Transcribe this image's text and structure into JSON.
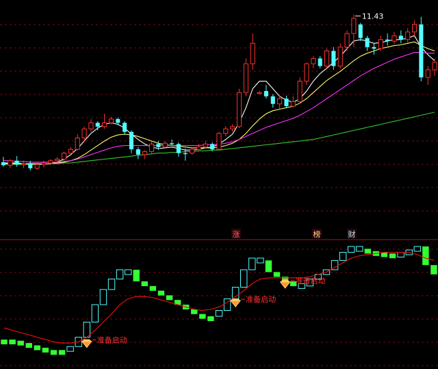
{
  "chart_data": [
    {
      "type": "candlestick",
      "peak_label": "11.43",
      "ylim": [
        9.0,
        11.55
      ],
      "grid": true,
      "candles": [
        {
          "o": 9.48,
          "h": 9.55,
          "l": 9.42,
          "c": 9.44,
          "up": false
        },
        {
          "o": 9.44,
          "h": 9.52,
          "l": 9.4,
          "c": 9.5,
          "up": true
        },
        {
          "o": 9.5,
          "h": 9.56,
          "l": 9.42,
          "c": 9.45,
          "up": false
        },
        {
          "o": 9.45,
          "h": 9.5,
          "l": 9.4,
          "c": 9.46,
          "up": true
        },
        {
          "o": 9.46,
          "h": 9.5,
          "l": 9.37,
          "c": 9.4,
          "up": false
        },
        {
          "o": 9.4,
          "h": 9.48,
          "l": 9.38,
          "c": 9.45,
          "up": true
        },
        {
          "o": 9.45,
          "h": 9.5,
          "l": 9.41,
          "c": 9.47,
          "up": true
        },
        {
          "o": 9.47,
          "h": 9.52,
          "l": 9.44,
          "c": 9.5,
          "up": true
        },
        {
          "o": 9.5,
          "h": 9.55,
          "l": 9.47,
          "c": 9.52,
          "up": true
        },
        {
          "o": 9.52,
          "h": 9.62,
          "l": 9.5,
          "c": 9.6,
          "up": true
        },
        {
          "o": 9.6,
          "h": 9.68,
          "l": 9.58,
          "c": 9.65,
          "up": true
        },
        {
          "o": 9.65,
          "h": 9.85,
          "l": 9.63,
          "c": 9.8,
          "up": true
        },
        {
          "o": 9.8,
          "h": 9.95,
          "l": 9.75,
          "c": 9.92,
          "up": true
        },
        {
          "o": 9.92,
          "h": 10.05,
          "l": 9.88,
          "c": 10.0,
          "up": true
        },
        {
          "o": 10.0,
          "h": 10.02,
          "l": 9.9,
          "c": 9.95,
          "up": false
        },
        {
          "o": 9.95,
          "h": 10.12,
          "l": 9.92,
          "c": 10.0,
          "up": true
        },
        {
          "o": 10.0,
          "h": 10.08,
          "l": 9.98,
          "c": 10.05,
          "up": true
        },
        {
          "o": 10.05,
          "h": 10.07,
          "l": 9.97,
          "c": 10.0,
          "up": false
        },
        {
          "o": 10.0,
          "h": 10.02,
          "l": 9.84,
          "c": 9.88,
          "up": false
        },
        {
          "o": 9.88,
          "h": 9.9,
          "l": 9.6,
          "c": 9.65,
          "up": false
        },
        {
          "o": 9.65,
          "h": 9.68,
          "l": 9.52,
          "c": 9.58,
          "up": false
        },
        {
          "o": 9.58,
          "h": 9.64,
          "l": 9.52,
          "c": 9.62,
          "up": true
        },
        {
          "o": 9.62,
          "h": 9.75,
          "l": 9.6,
          "c": 9.72,
          "up": true
        },
        {
          "o": 9.72,
          "h": 9.76,
          "l": 9.64,
          "c": 9.68,
          "up": false
        },
        {
          "o": 9.68,
          "h": 9.76,
          "l": 9.66,
          "c": 9.73,
          "up": true
        },
        {
          "o": 9.73,
          "h": 9.78,
          "l": 9.7,
          "c": 9.72,
          "up": false
        },
        {
          "o": 9.72,
          "h": 9.74,
          "l": 9.55,
          "c": 9.6,
          "up": false
        },
        {
          "o": 9.6,
          "h": 9.66,
          "l": 9.5,
          "c": 9.6,
          "up": false
        },
        {
          "o": 9.6,
          "h": 9.68,
          "l": 9.58,
          "c": 9.65,
          "up": true
        },
        {
          "o": 9.65,
          "h": 9.72,
          "l": 9.62,
          "c": 9.68,
          "up": true
        },
        {
          "o": 9.68,
          "h": 9.76,
          "l": 9.66,
          "c": 9.72,
          "up": true
        },
        {
          "o": 9.72,
          "h": 9.74,
          "l": 9.62,
          "c": 9.65,
          "up": false
        },
        {
          "o": 9.65,
          "h": 9.88,
          "l": 9.64,
          "c": 9.86,
          "up": true
        },
        {
          "o": 9.86,
          "h": 9.96,
          "l": 9.82,
          "c": 9.92,
          "up": true
        },
        {
          "o": 9.92,
          "h": 9.98,
          "l": 9.88,
          "c": 9.95,
          "up": true
        },
        {
          "o": 9.95,
          "h": 10.45,
          "l": 9.93,
          "c": 10.4,
          "up": true
        },
        {
          "o": 10.4,
          "h": 10.85,
          "l": 10.35,
          "c": 10.78,
          "up": true
        },
        {
          "o": 10.78,
          "h": 11.18,
          "l": 10.7,
          "c": 11.05,
          "up": true
        },
        {
          "o": 10.4,
          "h": 10.42,
          "l": 10.38,
          "c": 10.4,
          "up": true
        },
        {
          "o": 10.42,
          "h": 10.5,
          "l": 10.32,
          "c": 10.35,
          "up": false
        },
        {
          "o": 10.35,
          "h": 10.38,
          "l": 10.2,
          "c": 10.25,
          "up": false
        },
        {
          "o": 10.25,
          "h": 10.36,
          "l": 10.18,
          "c": 10.32,
          "up": true
        },
        {
          "o": 10.32,
          "h": 10.36,
          "l": 10.2,
          "c": 10.22,
          "up": false
        },
        {
          "o": 10.22,
          "h": 10.35,
          "l": 10.2,
          "c": 10.28,
          "up": true
        },
        {
          "o": 10.28,
          "h": 10.6,
          "l": 10.25,
          "c": 10.55,
          "up": true
        },
        {
          "o": 10.55,
          "h": 10.8,
          "l": 10.5,
          "c": 10.78,
          "up": true
        },
        {
          "o": 10.78,
          "h": 10.88,
          "l": 10.72,
          "c": 10.85,
          "up": true
        },
        {
          "o": 10.85,
          "h": 10.88,
          "l": 10.72,
          "c": 10.75,
          "up": false
        },
        {
          "o": 10.75,
          "h": 10.98,
          "l": 10.72,
          "c": 10.95,
          "up": true
        },
        {
          "o": 10.95,
          "h": 11.0,
          "l": 10.7,
          "c": 10.75,
          "up": false
        },
        {
          "o": 10.75,
          "h": 11.05,
          "l": 10.72,
          "c": 11.0,
          "up": true
        },
        {
          "o": 11.0,
          "h": 11.22,
          "l": 10.95,
          "c": 11.18,
          "up": true
        },
        {
          "o": 11.18,
          "h": 11.43,
          "l": 11.0,
          "c": 11.38,
          "up": true
        },
        {
          "o": 11.3,
          "h": 11.32,
          "l": 11.08,
          "c": 11.12,
          "up": false
        },
        {
          "o": 11.12,
          "h": 11.15,
          "l": 10.95,
          "c": 11.0,
          "up": false
        },
        {
          "o": 11.0,
          "h": 11.05,
          "l": 10.9,
          "c": 10.98,
          "up": false
        },
        {
          "o": 10.98,
          "h": 11.15,
          "l": 10.95,
          "c": 11.1,
          "up": true
        },
        {
          "o": 11.1,
          "h": 11.18,
          "l": 11.02,
          "c": 11.08,
          "up": false
        },
        {
          "o": 11.08,
          "h": 11.2,
          "l": 11.04,
          "c": 11.15,
          "up": true
        },
        {
          "o": 11.15,
          "h": 11.22,
          "l": 11.05,
          "c": 11.1,
          "up": false
        },
        {
          "o": 11.1,
          "h": 11.25,
          "l": 11.06,
          "c": 11.2,
          "up": true
        },
        {
          "o": 11.2,
          "h": 11.35,
          "l": 11.15,
          "c": 11.3,
          "up": true
        },
        {
          "o": 11.3,
          "h": 11.4,
          "l": 10.55,
          "c": 10.6,
          "up": false
        },
        {
          "o": 10.6,
          "h": 10.75,
          "l": 10.5,
          "c": 10.7,
          "up": true
        },
        {
          "o": 10.7,
          "h": 10.85,
          "l": 10.62,
          "c": 10.8,
          "up": true
        }
      ],
      "ma_lines": [
        {
          "color": "#ffffff",
          "values": [
            9.47,
            9.47,
            9.47,
            9.46,
            9.45,
            9.45,
            9.45,
            9.46,
            9.48,
            9.52,
            9.58,
            9.66,
            9.76,
            9.86,
            9.93,
            9.98,
            10.0,
            9.98,
            9.93,
            9.85,
            9.78,
            9.72,
            9.68,
            9.66,
            9.67,
            9.68,
            9.66,
            9.64,
            9.64,
            9.65,
            9.67,
            9.68,
            9.72,
            9.78,
            9.85,
            10.0,
            10.2,
            10.45,
            10.55,
            10.55,
            10.45,
            10.35,
            10.3,
            10.27,
            10.32,
            10.42,
            10.55,
            10.65,
            10.72,
            10.8,
            10.88,
            10.98,
            11.08,
            11.1,
            11.08,
            11.05,
            11.06,
            11.08,
            11.1,
            11.1,
            11.12,
            11.15,
            11.0,
            10.9,
            10.82
          ]
        },
        {
          "color": "#ffff66",
          "values": [
            9.46,
            9.46,
            9.46,
            9.46,
            9.46,
            9.46,
            9.46,
            9.46,
            9.47,
            9.48,
            9.5,
            9.53,
            9.58,
            9.64,
            9.7,
            9.76,
            9.81,
            9.84,
            9.85,
            9.84,
            9.82,
            9.79,
            9.76,
            9.73,
            9.71,
            9.7,
            9.69,
            9.68,
            9.67,
            9.67,
            9.67,
            9.67,
            9.68,
            9.7,
            9.73,
            9.78,
            9.86,
            9.96,
            10.05,
            10.12,
            10.16,
            10.18,
            10.2,
            10.22,
            10.26,
            10.32,
            10.4,
            10.48,
            10.56,
            10.62,
            10.68,
            10.75,
            10.82,
            10.88,
            10.92,
            10.95,
            10.98,
            11.0,
            11.02,
            11.03,
            11.05,
            11.07,
            11.02,
            10.98,
            10.95
          ]
        },
        {
          "color": "#ff33ff",
          "values": [
            9.5,
            9.5,
            9.49,
            9.49,
            9.48,
            9.48,
            9.48,
            9.48,
            9.48,
            9.49,
            9.5,
            9.52,
            9.55,
            9.58,
            9.61,
            9.64,
            9.67,
            9.69,
            9.7,
            9.7,
            9.7,
            9.7,
            9.7,
            9.7,
            9.7,
            9.7,
            9.7,
            9.7,
            9.7,
            9.7,
            9.71,
            9.71,
            9.72,
            9.73,
            9.75,
            9.78,
            9.82,
            9.86,
            9.9,
            9.94,
            9.97,
            10.0,
            10.03,
            10.06,
            10.1,
            10.15,
            10.2,
            10.26,
            10.32,
            10.38,
            10.44,
            10.5,
            10.56,
            10.62,
            10.67,
            10.72,
            10.76,
            10.8,
            10.84,
            10.87,
            10.9,
            10.93,
            10.93,
            10.92,
            10.92
          ]
        },
        {
          "color": "#33cc33",
          "values": [
            9.45,
            9.45,
            9.45,
            9.45,
            9.45,
            9.45,
            9.46,
            9.46,
            9.46,
            9.47,
            9.47,
            9.48,
            9.49,
            9.5,
            9.51,
            9.52,
            9.53,
            9.54,
            9.55,
            9.56,
            9.57,
            9.58,
            9.59,
            9.6,
            9.6,
            9.61,
            9.61,
            9.62,
            9.62,
            9.63,
            9.63,
            9.64,
            9.64,
            9.65,
            9.66,
            9.67,
            9.68,
            9.69,
            9.7,
            9.71,
            9.72,
            9.73,
            9.74,
            9.75,
            9.76,
            9.77,
            9.78,
            9.8,
            9.82,
            9.84,
            9.86,
            9.88,
            9.9,
            9.92,
            9.94,
            9.96,
            9.98,
            10.0,
            10.02,
            10.04,
            10.06,
            10.08,
            10.1,
            10.12,
            10.14
          ]
        }
      ],
      "markers": [
        "涨",
        "榜",
        "财"
      ]
    },
    {
      "type": "indicator",
      "ylim": [
        0,
        100
      ],
      "signal_label": "准备启动",
      "bars": [
        {
          "v": 20,
          "up": false
        },
        {
          "v": 19,
          "up": false
        },
        {
          "v": 17,
          "up": false
        },
        {
          "v": 15,
          "up": false
        },
        {
          "v": 13,
          "up": false
        },
        {
          "v": 11,
          "up": false
        },
        {
          "v": 10,
          "up": false
        },
        {
          "v": 11,
          "up": false
        },
        {
          "v": 14,
          "up": true
        },
        {
          "v": 22,
          "up": true
        },
        {
          "v": 35,
          "up": true
        },
        {
          "v": 50,
          "up": true
        },
        {
          "v": 63,
          "up": true
        },
        {
          "v": 72,
          "up": true
        },
        {
          "v": 80,
          "up": true
        },
        {
          "v": 80,
          "up": true
        },
        {
          "v": 70,
          "up": false
        },
        {
          "v": 66,
          "up": false
        },
        {
          "v": 62,
          "up": false
        },
        {
          "v": 58,
          "up": false
        },
        {
          "v": 54,
          "up": false
        },
        {
          "v": 50,
          "up": false
        },
        {
          "v": 46,
          "up": false
        },
        {
          "v": 42,
          "up": false
        },
        {
          "v": 40,
          "up": false
        },
        {
          "v": 40,
          "up": false
        },
        {
          "v": 45,
          "up": true
        },
        {
          "v": 55,
          "up": true
        },
        {
          "v": 65,
          "up": true
        },
        {
          "v": 80,
          "up": true
        },
        {
          "v": 90,
          "up": true
        },
        {
          "v": 88,
          "up": true
        },
        {
          "v": 78,
          "up": false
        },
        {
          "v": 74,
          "up": false
        },
        {
          "v": 70,
          "up": false
        },
        {
          "v": 68,
          "up": false
        },
        {
          "v": 66,
          "up": true
        },
        {
          "v": 72,
          "up": true
        },
        {
          "v": 76,
          "up": true
        },
        {
          "v": 80,
          "up": true
        },
        {
          "v": 88,
          "up": true
        },
        {
          "v": 95,
          "up": true
        },
        {
          "v": 100,
          "up": true
        },
        {
          "v": 98,
          "up": true
        },
        {
          "v": 96,
          "up": false
        },
        {
          "v": 95,
          "up": false
        },
        {
          "v": 94,
          "up": false
        },
        {
          "v": 94,
          "up": false
        },
        {
          "v": 95,
          "up": true
        },
        {
          "v": 97,
          "up": true
        },
        {
          "v": 100,
          "up": true
        },
        {
          "v": 84,
          "up": false
        },
        {
          "v": 76,
          "up": false
        }
      ],
      "signal_line": [
        30,
        28,
        26,
        24,
        22,
        20,
        18,
        17,
        17,
        18,
        22,
        28,
        35,
        42,
        50,
        55,
        57,
        57,
        56,
        54,
        52,
        50,
        48,
        46,
        45,
        46,
        48,
        52,
        57,
        62,
        68,
        72,
        73,
        73,
        73,
        73,
        73,
        74,
        76,
        78,
        82,
        86,
        90,
        92,
        93,
        94,
        95,
        95,
        95,
        95,
        93,
        90,
        88
      ],
      "signals": [
        {
          "bar": 10,
          "label": "准备启动"
        },
        {
          "bar": 28,
          "label": "准备启动"
        },
        {
          "bar": 34,
          "label": "准备启动"
        }
      ]
    }
  ]
}
